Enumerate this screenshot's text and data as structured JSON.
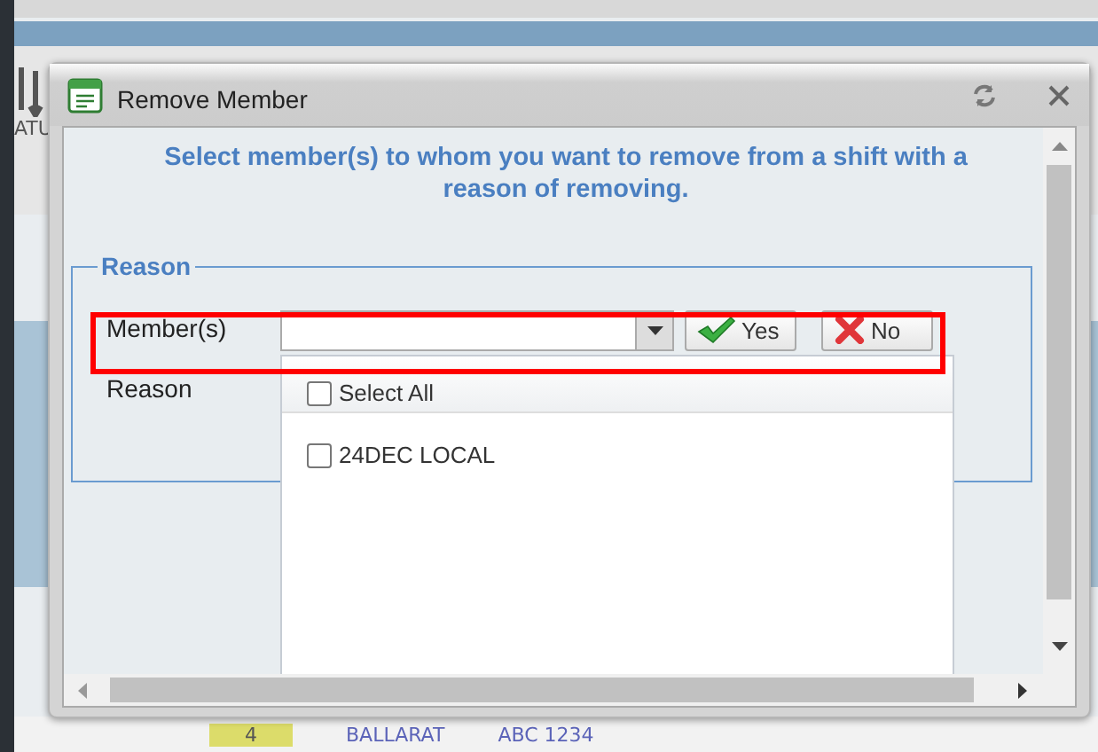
{
  "background": {
    "toolbar_label": "ATU",
    "footer": [
      "4",
      "BALLARAT",
      "ABC 1234"
    ]
  },
  "dialog": {
    "title": "Remove Member",
    "instruction": "Select member(s) to whom you want to remove from a shift with a reason of removing.",
    "fieldset": {
      "legend": "Reason",
      "labels": [
        "Member(s)",
        "Reason"
      ]
    },
    "buttons": [
      {
        "label": "Yes",
        "kind": "confirm"
      },
      {
        "label": "No",
        "kind": "cancel"
      }
    ],
    "dropdown": {
      "select_all": {
        "label": "Select All",
        "checked": false
      },
      "options": [
        {
          "label": "24DEC LOCAL",
          "checked": false
        }
      ]
    },
    "highlight": true
  }
}
